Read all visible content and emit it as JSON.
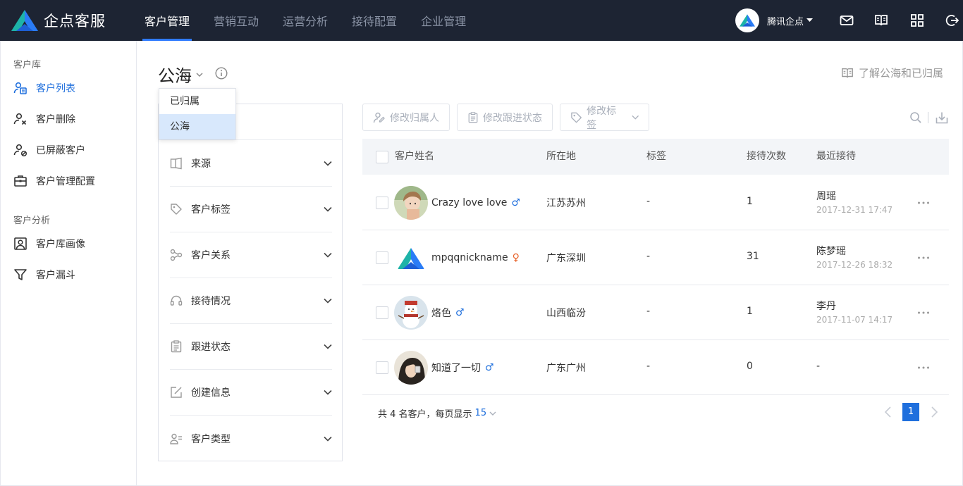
{
  "app": {
    "brand": "企点客服"
  },
  "nav": {
    "items": [
      {
        "label": "客户管理",
        "active": true
      },
      {
        "label": "营销互动"
      },
      {
        "label": "运营分析"
      },
      {
        "label": "接待配置"
      },
      {
        "label": "企业管理"
      }
    ]
  },
  "user": {
    "name": "腾讯企点"
  },
  "top_icons": [
    "mail-icon",
    "book-icon",
    "apps-icon",
    "logout-icon"
  ],
  "sidebar": {
    "group1": "客户库",
    "items1": [
      {
        "label": "客户列表",
        "icon": "customer-list-icon",
        "active": true
      },
      {
        "label": "客户删除",
        "icon": "customer-delete-icon"
      },
      {
        "label": "已屏蔽客户",
        "icon": "blocked-customer-icon"
      },
      {
        "label": "客户管理配置",
        "icon": "config-icon"
      }
    ],
    "group2": "客户分析",
    "items2": [
      {
        "label": "客户库画像",
        "icon": "portrait-icon"
      },
      {
        "label": "客户漏斗",
        "icon": "funnel-icon"
      }
    ]
  },
  "page": {
    "title": "公海",
    "learn_link": "了解公海和已归属"
  },
  "dropdown": {
    "options": [
      "已归属",
      "公海"
    ],
    "selected": "公海"
  },
  "filters": [
    {
      "label": "来源",
      "icon": "source-icon"
    },
    {
      "label": "客户标签",
      "icon": "tag-icon"
    },
    {
      "label": "客户关系",
      "icon": "relation-icon"
    },
    {
      "label": "接待情况",
      "icon": "headset-icon"
    },
    {
      "label": "跟进状态",
      "icon": "clipboard-icon"
    },
    {
      "label": "创建信息",
      "icon": "edit-icon"
    },
    {
      "label": "客户类型",
      "icon": "user-type-icon"
    }
  ],
  "toolbar": {
    "change_owner": "修改归属人",
    "change_status": "修改跟进状态",
    "change_tags": "修改标签"
  },
  "table": {
    "headers": [
      "客户姓名",
      "所在地",
      "标签",
      "接待次数",
      "最近接待"
    ],
    "rows": [
      {
        "name": "Crazy love love",
        "gender": "♂",
        "gender_type": "male",
        "location": "江苏苏州",
        "tags": "-",
        "visits": "1",
        "last_agent": "周瑶",
        "last_time": "2017-12-31 17:47",
        "avatar": "girl-photo"
      },
      {
        "name": "mpqqnickname",
        "gender": "♀",
        "gender_type": "female",
        "location": "广东深圳",
        "tags": "-",
        "visits": "31",
        "last_agent": "陈梦瑶",
        "last_time": "2017-12-26 18:32",
        "avatar": "logo-avatar"
      },
      {
        "name": "烙色",
        "gender": "♂",
        "gender_type": "male",
        "location": "山西临汾",
        "tags": "-",
        "visits": "1",
        "last_agent": "李丹",
        "last_time": "2017-11-07 14:17",
        "avatar": "snowman-photo"
      },
      {
        "name": "知道了一切",
        "gender": "♂",
        "gender_type": "male",
        "location": "广东广州",
        "tags": "-",
        "visits": "0",
        "last_agent": "-",
        "last_time": "",
        "avatar": "dark-hair-photo"
      }
    ]
  },
  "footer": {
    "summary": "共 4 名客户，每页显示",
    "page_size": "15",
    "current_page": "1"
  },
  "colors": {
    "accent": "#1f6fdd",
    "topbar": "#1d2433"
  }
}
